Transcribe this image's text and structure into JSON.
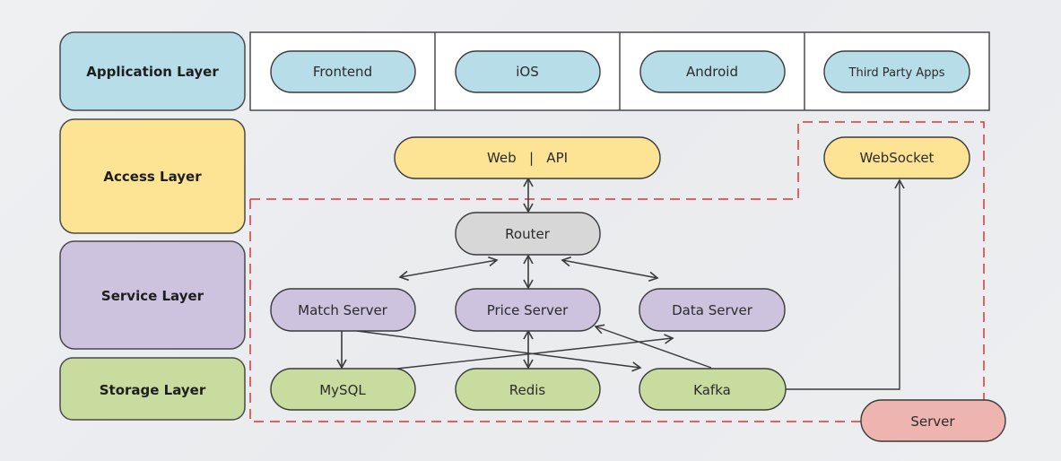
{
  "colors": {
    "application": "#b7dde8",
    "access": "#fde394",
    "service": "#cdc3de",
    "storage": "#c9dc9f",
    "router": "#d7d7d7",
    "server": "#eeb5b0",
    "boundary": "#d9343a",
    "stroke": "#3a3a3a"
  },
  "layers": [
    {
      "id": "application",
      "label": "Application Layer"
    },
    {
      "id": "access",
      "label": "Access Layer"
    },
    {
      "id": "service",
      "label": "Service Layer"
    },
    {
      "id": "storage",
      "label": "Storage Layer"
    }
  ],
  "nodes": {
    "frontend": "Frontend",
    "ios": "iOS",
    "android": "Android",
    "third_party": "Third Party Apps",
    "web_api": "Web   |   API",
    "websocket": "WebSocket",
    "router": "Router",
    "match_server": "Match Server",
    "price_server": "Price Server",
    "data_server": "Data Server",
    "mysql": "MySQL",
    "redis": "Redis",
    "kafka": "Kafka",
    "server": "Server"
  },
  "edges": [
    {
      "from": "web_api",
      "to": "router",
      "type": "bidirectional"
    },
    {
      "from": "router",
      "to": "match_server",
      "type": "bidirectional"
    },
    {
      "from": "router",
      "to": "price_server",
      "type": "bidirectional"
    },
    {
      "from": "router",
      "to": "data_server",
      "type": "bidirectional"
    },
    {
      "from": "match_server",
      "to": "mysql",
      "type": "directed"
    },
    {
      "from": "match_server",
      "to": "kafka",
      "type": "directed"
    },
    {
      "from": "mysql",
      "to": "data_server",
      "type": "directed"
    },
    {
      "from": "price_server",
      "to": "redis",
      "type": "bidirectional"
    },
    {
      "from": "kafka",
      "to": "price_server",
      "type": "directed"
    },
    {
      "from": "kafka",
      "to": "websocket",
      "type": "directed"
    }
  ],
  "boundary_label": "Server"
}
